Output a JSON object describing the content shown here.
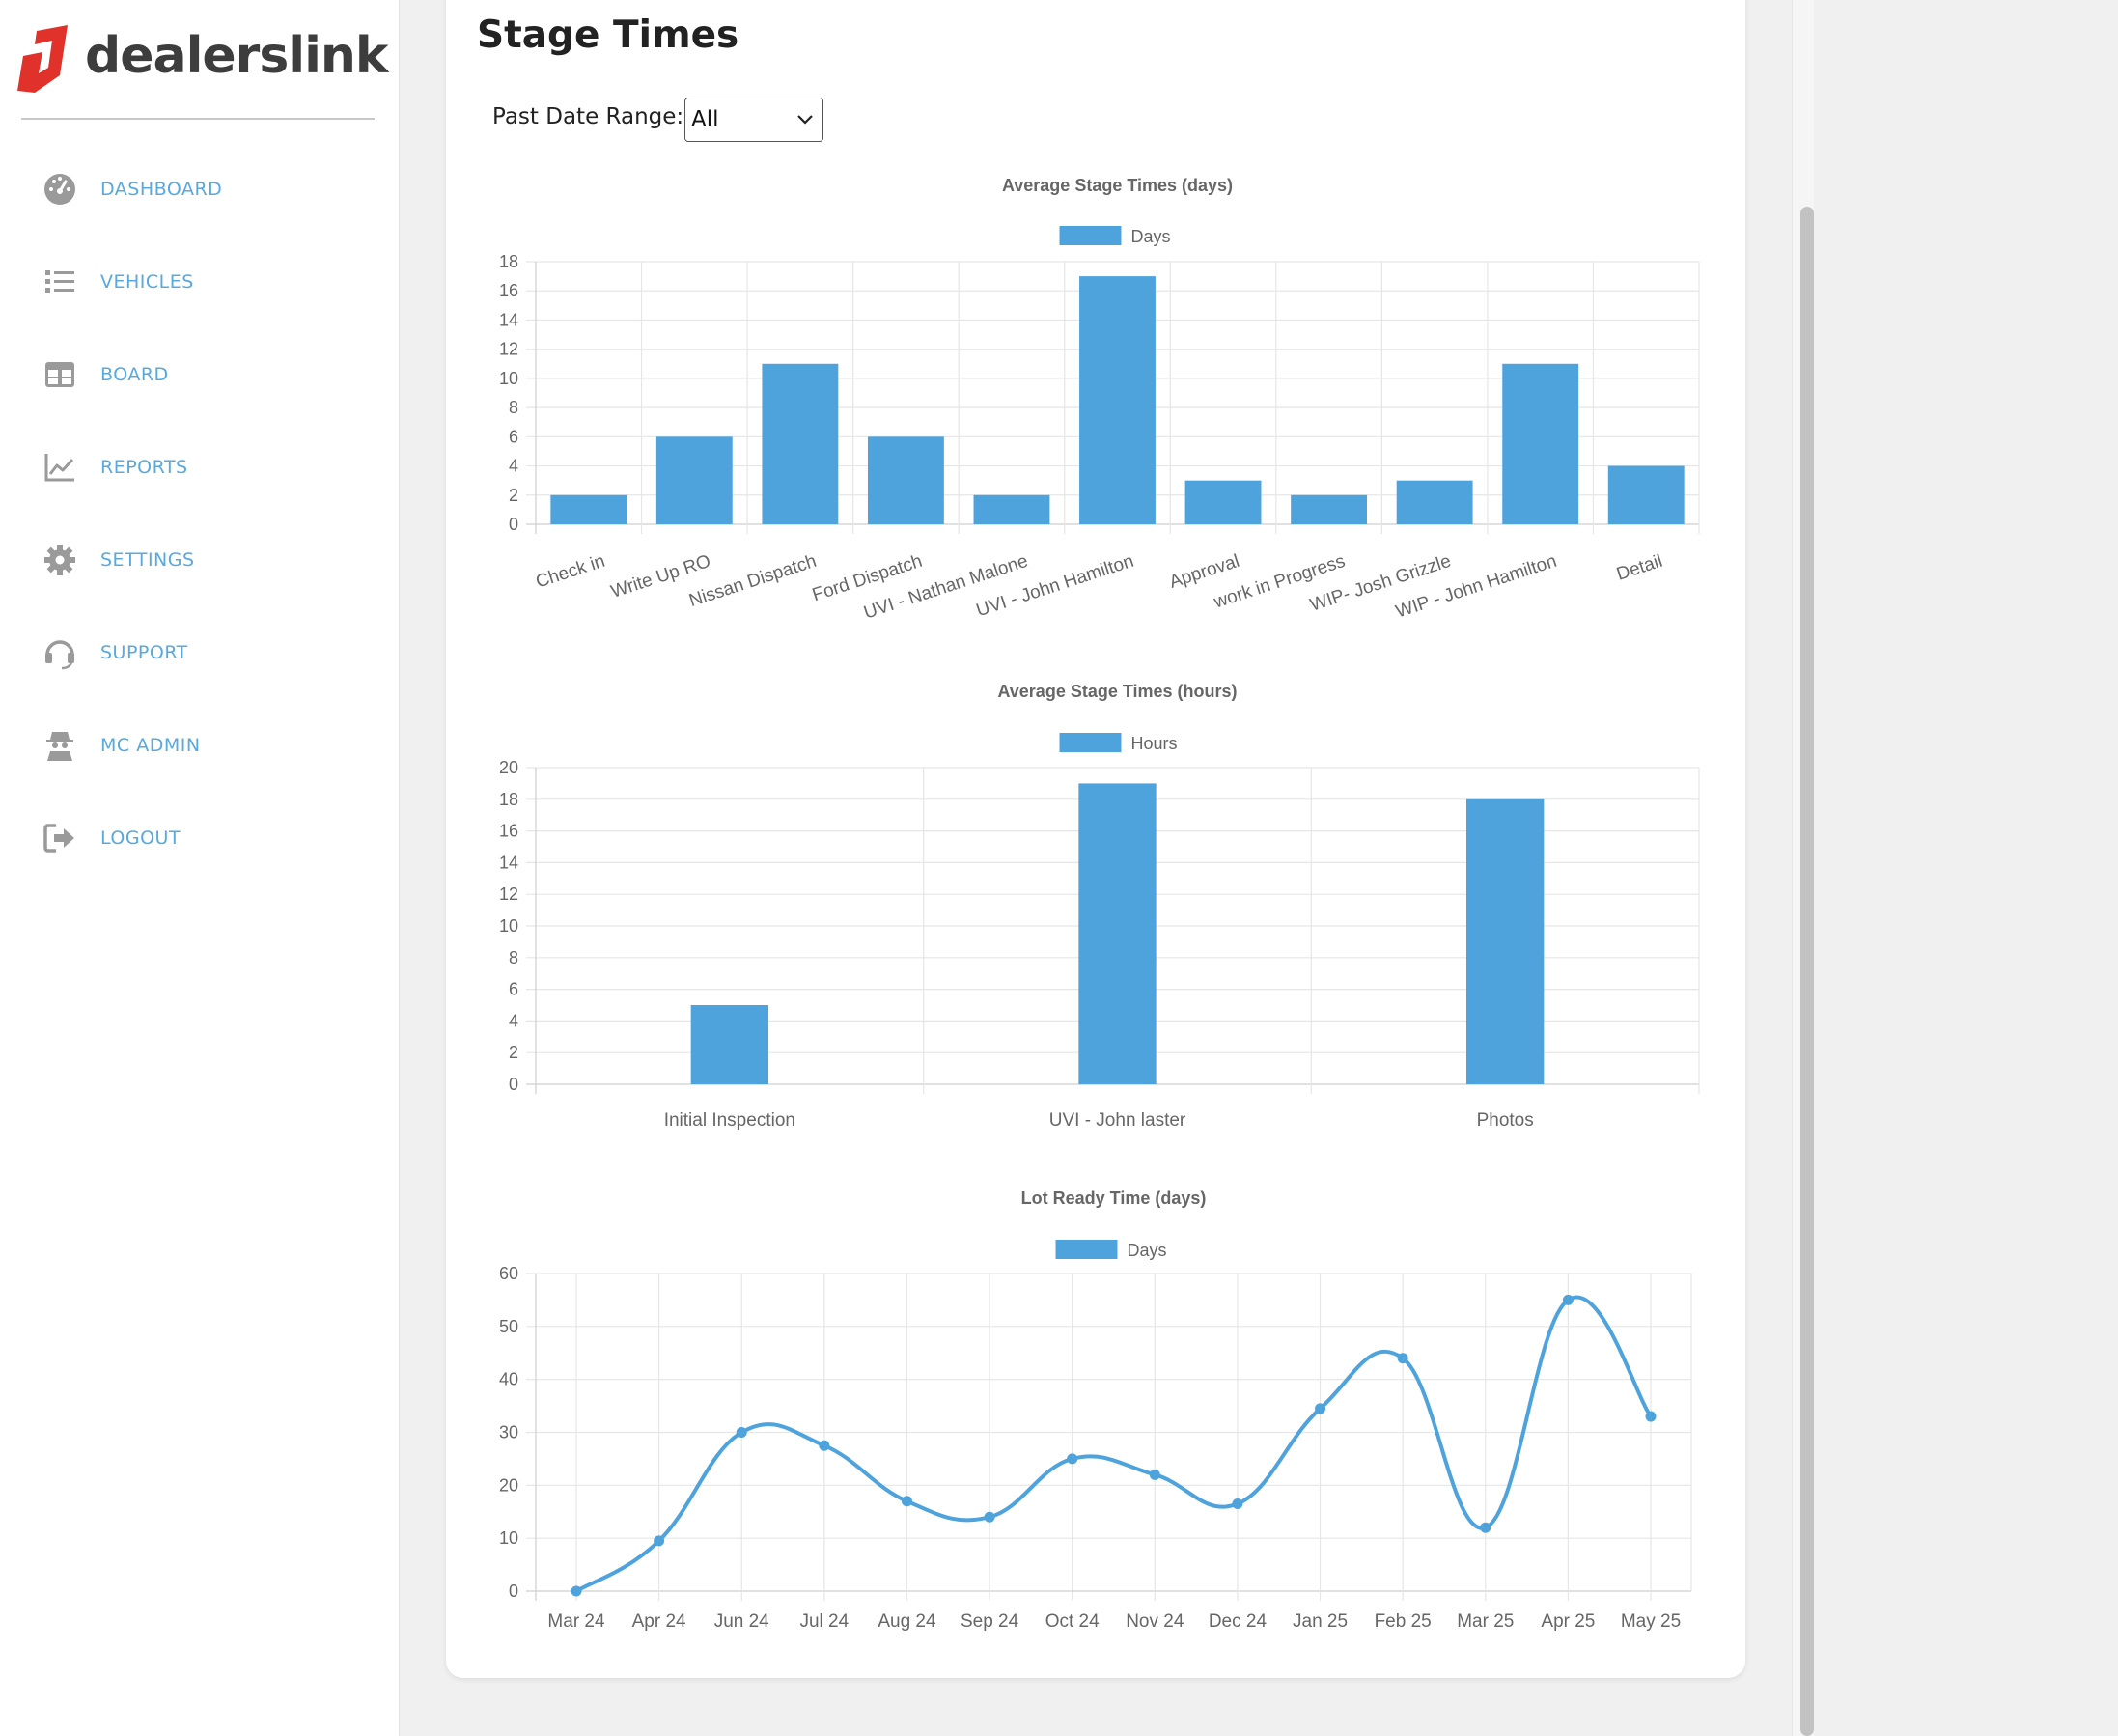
{
  "brand": {
    "name": "dealerslink",
    "logo_color": "#e0312b"
  },
  "nav": {
    "items": [
      {
        "label": "DASHBOARD",
        "icon": "dashboard-gauge-icon"
      },
      {
        "label": "VEHICLES",
        "icon": "list-icon"
      },
      {
        "label": "BOARD",
        "icon": "board-table-icon"
      },
      {
        "label": "REPORTS",
        "icon": "line-chart-icon"
      },
      {
        "label": "SETTINGS",
        "icon": "gear-icon"
      },
      {
        "label": "SUPPORT",
        "icon": "headset-icon"
      },
      {
        "label": "MC ADMIN",
        "icon": "user-secret-icon"
      },
      {
        "label": "LOGOUT",
        "icon": "sign-out-icon"
      }
    ],
    "label_color": "#57a9de",
    "icon_color": "#9a9a9a"
  },
  "page": {
    "title": "Stage Times",
    "date_range": {
      "label": "Past Date Range:",
      "value": "All"
    }
  },
  "colors": {
    "series": "#4fa3dc",
    "grid": "#e6e6e6",
    "axis": "#cfcfcf"
  },
  "chart_data": [
    {
      "type": "bar",
      "title": "Average Stage Times (days)",
      "categories": [
        "Check in",
        "Write Up RO",
        "Nissan Dispatch",
        "Ford Dispatch",
        "UVI - Nathan Malone",
        "UVI - John Hamilton",
        "Approval",
        "work in Progress",
        "WIP- Josh Grizzle",
        "WIP - John Hamilton",
        "Detail"
      ],
      "series": [
        {
          "name": "Days",
          "values": [
            2,
            6,
            11,
            6,
            2,
            17,
            3,
            2,
            3,
            11,
            4
          ]
        }
      ],
      "ylim": [
        0,
        18
      ],
      "yticks": [
        0,
        2,
        4,
        6,
        8,
        10,
        12,
        14,
        16,
        18
      ],
      "grid": true,
      "legend": "top-center",
      "xlabel": "",
      "ylabel": ""
    },
    {
      "type": "bar",
      "title": "Average Stage Times (hours)",
      "categories": [
        "Initial Inspection",
        "UVI - John laster",
        "Photos"
      ],
      "series": [
        {
          "name": "Hours",
          "values": [
            5,
            19,
            18
          ]
        }
      ],
      "ylim": [
        0,
        20
      ],
      "yticks": [
        0,
        2,
        4,
        6,
        8,
        10,
        12,
        14,
        16,
        18,
        20
      ],
      "grid": true,
      "legend": "top-center",
      "xlabel": "",
      "ylabel": ""
    },
    {
      "type": "line",
      "title": "Lot Ready Time (days)",
      "categories": [
        "Mar 24",
        "Apr 24",
        "Jun 24",
        "Jul 24",
        "Aug 24",
        "Sep 24",
        "Oct 24",
        "Nov 24",
        "Dec 24",
        "Jan 25",
        "Feb 25",
        "Mar 25",
        "Apr 25",
        "May 25"
      ],
      "series": [
        {
          "name": "Days",
          "values": [
            0,
            9.5,
            30,
            27.5,
            17,
            14,
            25,
            22,
            16.5,
            34.5,
            44,
            12,
            55,
            33
          ]
        }
      ],
      "ylim": [
        0,
        60
      ],
      "yticks": [
        0,
        10,
        20,
        30,
        40,
        50,
        60
      ],
      "grid": true,
      "legend": "top-center",
      "xlabel": "",
      "ylabel": ""
    }
  ]
}
